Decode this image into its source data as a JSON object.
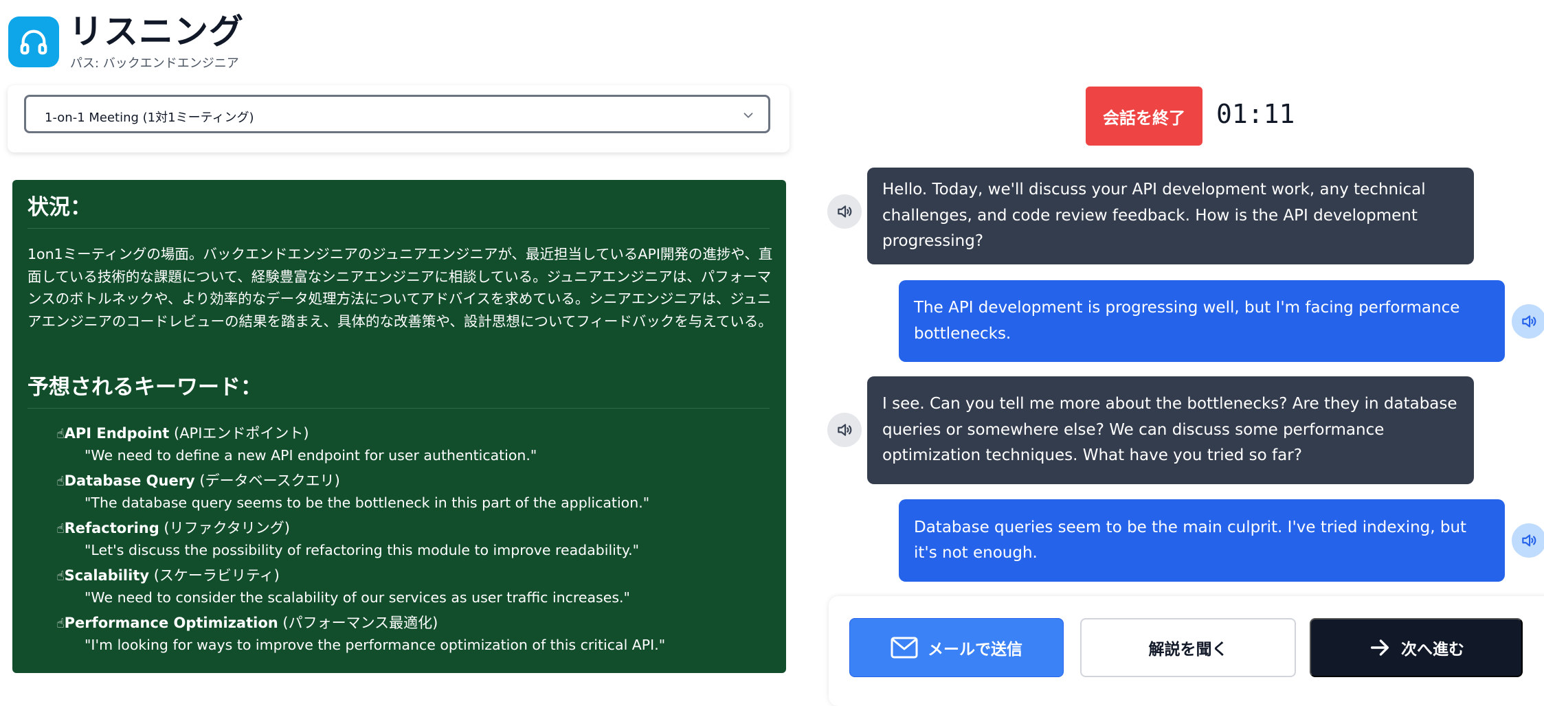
{
  "header": {
    "icon": "headphones-icon",
    "title": "リスニング",
    "subtitle": "パス: バックエンドエンジニア"
  },
  "scenario_select": {
    "selected": "1-on-1 Meeting (1対1ミーティング)"
  },
  "situation": {
    "heading": "状況：",
    "text": "1on1ミーティングの場面。バックエンドエンジニアのジュニアエンジニアが、最近担当しているAPI開発の進捗や、直面している技術的な課題について、経験豊富なシニアエンジニアに相談している。ジュニアエンジニアは、パフォーマンスのボトルネックや、より効率的なデータ処理方法についてアドバイスを求めている。シニアエンジニアは、ジュニアエンジニアのコードレビューの結果を踏まえ、具体的な改善策や、設計思想についてフィードバックを与えている。",
    "keywords_heading": "予想されるキーワード：",
    "keywords": [
      {
        "hand": "☝",
        "term": "API Endpoint",
        "translation": " (APIエンドポイント)",
        "example": "\"We need to define a new API endpoint for user authentication.\""
      },
      {
        "hand": "☝",
        "term": "Database Query",
        "translation": " (データベースクエリ)",
        "example": "\"The database query seems to be the bottleneck in this part of the application.\""
      },
      {
        "hand": "☝",
        "term": "Refactoring",
        "translation": " (リファクタリング)",
        "example": "\"Let's discuss the possibility of refactoring this module to improve readability.\""
      },
      {
        "hand": "☝",
        "term": "Scalability",
        "translation": " (スケーラビリティ)",
        "example": "\"We need to consider the scalability of our services as user traffic increases.\""
      },
      {
        "hand": "☝",
        "term": "Performance Optimization",
        "translation": " (パフォーマンス最適化)",
        "example": "\"I'm looking for ways to improve the performance optimization of this critical API.\""
      }
    ]
  },
  "controls": {
    "end_label": "会話を終了",
    "timer": "01:11"
  },
  "messages": [
    {
      "role": "ai",
      "text": "Hello. Today, we'll discuss your API development work, any technical challenges, and code review feedback. How is the API development progressing?"
    },
    {
      "role": "user",
      "text": "The API development is progressing well, but I'm facing performance bottlenecks."
    },
    {
      "role": "ai",
      "text": "I see. Can you tell me more about the bottlenecks? Are they in database queries or somewhere else? We can discuss some performance optimization techniques. What have you tried so far?"
    },
    {
      "role": "user",
      "text": "Database queries seem to be the main culprit. I've tried indexing, but it's not enough."
    }
  ],
  "actions": {
    "mail_label": "メールで送信",
    "explain_label": "解説を聞く",
    "next_label": "次へ進む"
  },
  "colors": {
    "accent_blue": "#2563eb",
    "end_red": "#ef4444",
    "situation_green": "#134e2c",
    "ai_bubble": "#343d4e",
    "dark_button": "#111827"
  }
}
